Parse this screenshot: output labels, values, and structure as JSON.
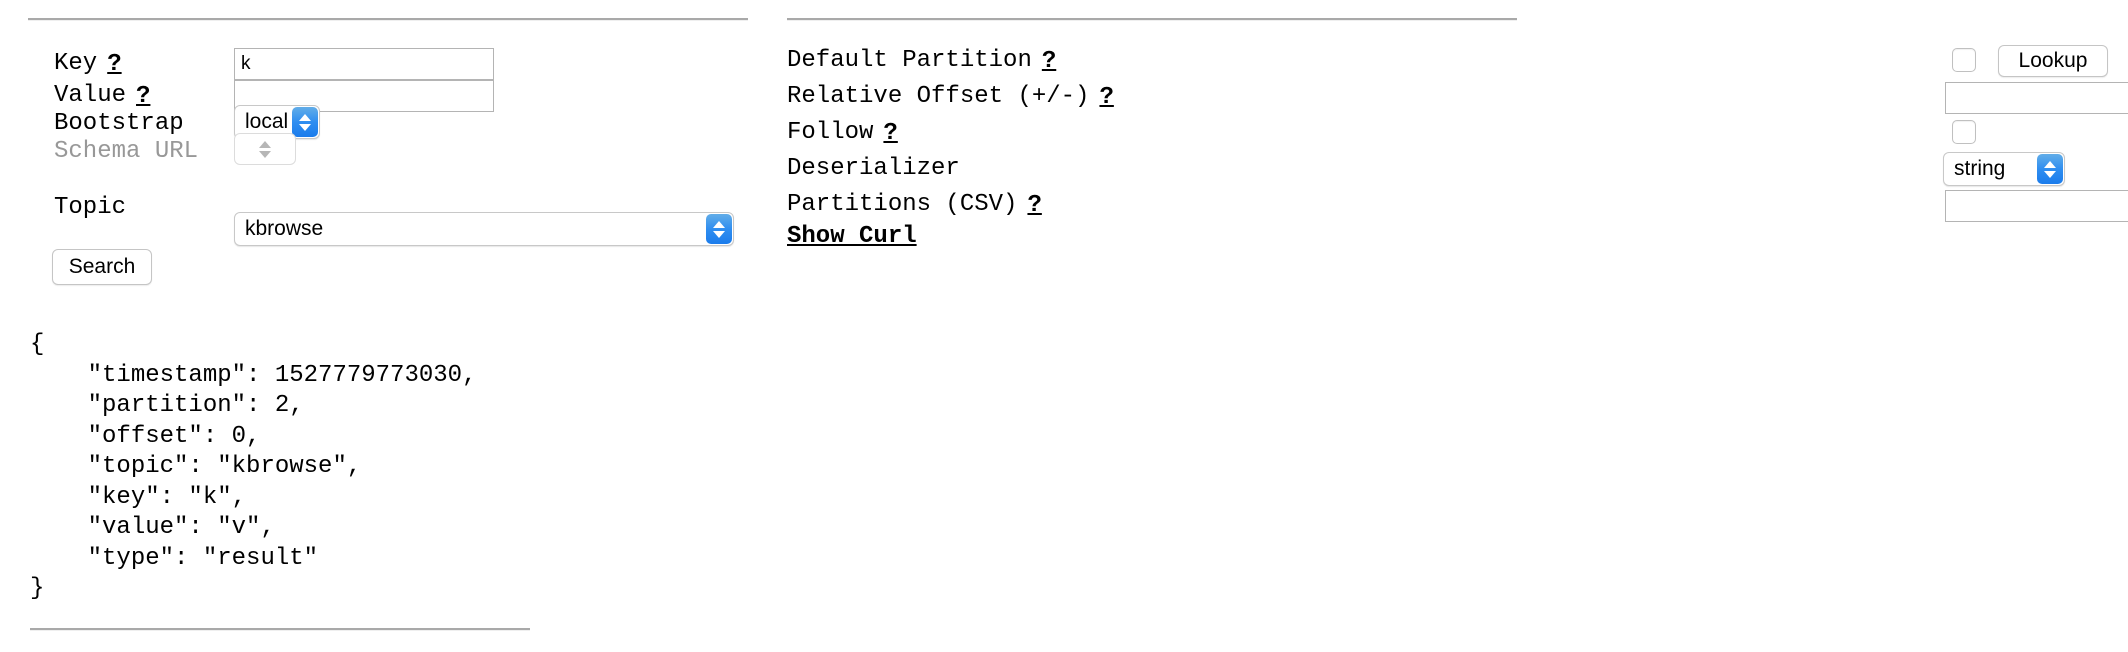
{
  "rules": {
    "left_top": "divider",
    "right_top": "divider",
    "bottom": "divider"
  },
  "search_form": {
    "rows": [
      {
        "label": "Key",
        "help": "?",
        "value": "k",
        "placeholder": ""
      },
      {
        "label": "Value",
        "help": "?",
        "value": "",
        "placeholder": ""
      },
      {
        "label": "Bootstrap",
        "help": "",
        "value": "local"
      },
      {
        "label": "Schema URL",
        "help": "",
        "value": ""
      },
      {
        "label": "Topic",
        "help": "",
        "value": "kbrowse"
      }
    ],
    "search_button": "Search"
  },
  "options_form": {
    "rows": [
      {
        "label": "Default Partition",
        "help": "?",
        "value": ""
      },
      {
        "label": "Relative Offset (+/-)",
        "help": "?",
        "value": "",
        "placeholder": ""
      },
      {
        "label": "Follow",
        "help": "?",
        "value": ""
      },
      {
        "label": "Deserializer",
        "help": "",
        "value": "string"
      },
      {
        "label": "Partitions (CSV)",
        "help": "?",
        "value": "",
        "placeholder": ""
      }
    ],
    "lookup_button": "Lookup",
    "show_curl": "Show Curl"
  },
  "result": {
    "json": "{\n    \"timestamp\": 1527779773030,\n    \"partition\": 2,\n    \"offset\": 0,\n    \"topic\": \"kbrowse\",\n    \"key\": \"k\",\n    \"value\": \"v\",\n    \"type\": \"result\"\n}",
    "fields": {
      "timestamp": 1527779773030,
      "partition": 2,
      "offset": 0,
      "topic": "kbrowse",
      "key": "k",
      "value": "v",
      "type": "result"
    }
  },
  "colors": {
    "stepper_blue": "#2f8ef0",
    "rule_gray": "#a9a9a9",
    "disabled_label": "#989898",
    "input_border": "#b4b4b4"
  }
}
